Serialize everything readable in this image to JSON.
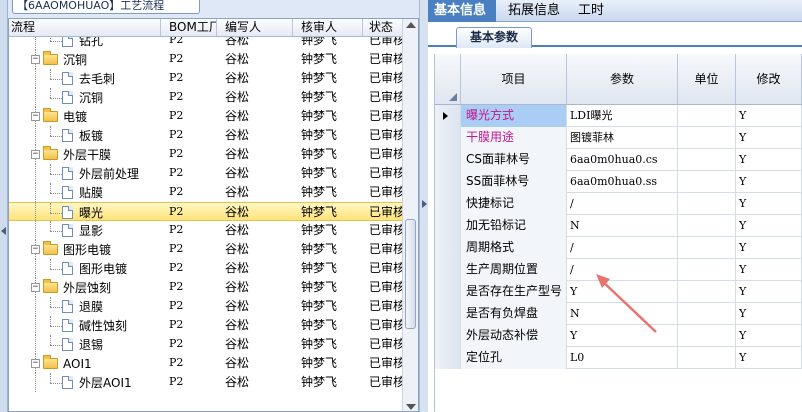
{
  "left_title": "【6AAOMOHUAO】工艺流程",
  "tree": {
    "columns": [
      "流程",
      "BOM工厂",
      "编写人",
      "核审人",
      "状态"
    ],
    "rows": [
      {
        "label": "钻孔",
        "level": 2,
        "kind": "leaf",
        "bom": "P2",
        "editor": "谷松",
        "auditor": "钟梦飞",
        "status": "已审核"
      },
      {
        "label": "沉铜",
        "level": 1,
        "kind": "folder",
        "bom": "P2",
        "editor": "谷松",
        "auditor": "钟梦飞",
        "status": "已审核"
      },
      {
        "label": "去毛刺",
        "level": 2,
        "kind": "leaf",
        "bom": "P2",
        "editor": "谷松",
        "auditor": "钟梦飞",
        "status": "已审核"
      },
      {
        "label": "沉铜",
        "level": 2,
        "kind": "leaf",
        "bom": "P2",
        "editor": "谷松",
        "auditor": "钟梦飞",
        "status": "已审核"
      },
      {
        "label": "电镀",
        "level": 1,
        "kind": "folder",
        "bom": "P2",
        "editor": "谷松",
        "auditor": "钟梦飞",
        "status": "已审核"
      },
      {
        "label": "板镀",
        "level": 2,
        "kind": "leaf",
        "bom": "P2",
        "editor": "谷松",
        "auditor": "钟梦飞",
        "status": "已审核"
      },
      {
        "label": "外层干膜",
        "level": 1,
        "kind": "folder",
        "bom": "P2",
        "editor": "谷松",
        "auditor": "钟梦飞",
        "status": "已审核"
      },
      {
        "label": "外层前处理",
        "level": 2,
        "kind": "leaf",
        "bom": "P2",
        "editor": "谷松",
        "auditor": "钟梦飞",
        "status": "已审核"
      },
      {
        "label": "贴膜",
        "level": 2,
        "kind": "leaf",
        "bom": "P2",
        "editor": "谷松",
        "auditor": "钟梦飞",
        "status": "已审核"
      },
      {
        "label": "曝光",
        "level": 2,
        "kind": "leaf",
        "bom": "P2",
        "editor": "谷松",
        "auditor": "钟梦飞",
        "status": "已审核",
        "selected": true
      },
      {
        "label": "显影",
        "level": 2,
        "kind": "leaf",
        "bom": "P2",
        "editor": "谷松",
        "auditor": "钟梦飞",
        "status": "已审核"
      },
      {
        "label": "图形电镀",
        "level": 1,
        "kind": "folder",
        "bom": "P2",
        "editor": "谷松",
        "auditor": "钟梦飞",
        "status": "已审核"
      },
      {
        "label": "图形电镀",
        "level": 2,
        "kind": "leaf",
        "bom": "P2",
        "editor": "谷松",
        "auditor": "钟梦飞",
        "status": "已审核"
      },
      {
        "label": "外层蚀刻",
        "level": 1,
        "kind": "folder",
        "bom": "P2",
        "editor": "谷松",
        "auditor": "钟梦飞",
        "status": "已审核"
      },
      {
        "label": "退膜",
        "level": 2,
        "kind": "leaf",
        "bom": "P2",
        "editor": "谷松",
        "auditor": "钟梦飞",
        "status": "已审核"
      },
      {
        "label": "碱性蚀刻",
        "level": 2,
        "kind": "leaf",
        "bom": "P2",
        "editor": "谷松",
        "auditor": "钟梦飞",
        "status": "已审核"
      },
      {
        "label": "退锡",
        "level": 2,
        "kind": "leaf",
        "bom": "P2",
        "editor": "谷松",
        "auditor": "钟梦飞",
        "status": "已审核"
      },
      {
        "label": "AOI1",
        "level": 1,
        "kind": "folder",
        "bom": "P2",
        "editor": "谷松",
        "auditor": "钟梦飞",
        "status": "已审核"
      },
      {
        "label": "外层AOI1",
        "level": 2,
        "kind": "leaf",
        "bom": "P2",
        "editor": "谷松",
        "auditor": "钟梦飞",
        "status": "已审核"
      }
    ]
  },
  "top_tabs": [
    "基本信息",
    "拓展信息",
    "工时"
  ],
  "sub_tab": "基本参数",
  "grid": {
    "columns": [
      "项目",
      "参数",
      "单位",
      "修改"
    ],
    "rows": [
      {
        "item": "曝光方式",
        "param": "LDI曝光",
        "unit": "",
        "modify": "Y",
        "highlight": true,
        "current": true
      },
      {
        "item": "干膜用途",
        "param": "图镀菲林",
        "unit": "",
        "modify": "Y",
        "highlight": true
      },
      {
        "item": "CS面菲林号",
        "param": "6aa0m0hua0.cs",
        "unit": "",
        "modify": "Y"
      },
      {
        "item": "SS面菲林号",
        "param": "6aa0m0hua0.ss",
        "unit": "",
        "modify": "Y"
      },
      {
        "item": "快捷标记",
        "param": "/",
        "unit": "",
        "modify": "Y"
      },
      {
        "item": "加无铅标记",
        "param": "N",
        "unit": "",
        "modify": "Y"
      },
      {
        "item": "周期格式",
        "param": "/",
        "unit": "",
        "modify": "Y"
      },
      {
        "item": "生产周期位置",
        "param": "/",
        "unit": "",
        "modify": "Y"
      },
      {
        "item": "是否存在生产型号",
        "param": "Y",
        "unit": "",
        "modify": "Y"
      },
      {
        "item": "是否有负焊盘",
        "param": "N",
        "unit": "",
        "modify": "Y"
      },
      {
        "item": "外层动态补偿",
        "param": "Y",
        "unit": "",
        "modify": "Y"
      },
      {
        "item": "定位孔",
        "param": "L0",
        "unit": "",
        "modify": "Y"
      }
    ]
  },
  "colors": {
    "accent": "#4a7fc1",
    "highlight_text": "#c3158f",
    "annotation_arrow": "#e8736f",
    "selection": "#ffe37a"
  }
}
